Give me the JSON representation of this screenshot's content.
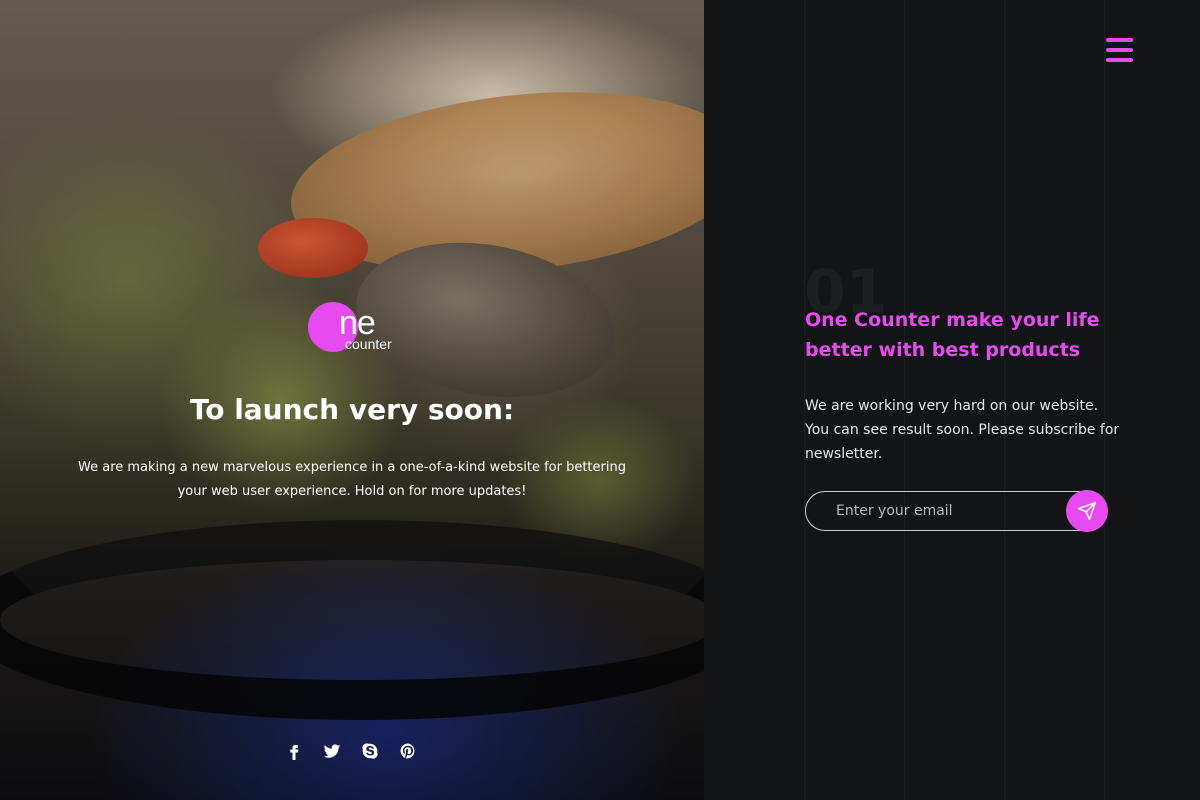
{
  "brand": {
    "logo_main": "ne",
    "logo_sub": "counter",
    "accent_color": "#e64bf0"
  },
  "hero": {
    "title": "To launch very soon:",
    "description": "We are making a new marvelous experience in a one-of-a-kind website for bettering your web user experience. Hold on for more updates!",
    "socials": [
      {
        "icon": "facebook-icon"
      },
      {
        "icon": "twitter-icon"
      },
      {
        "icon": "skype-icon"
      },
      {
        "icon": "pinterest-icon"
      }
    ]
  },
  "panel": {
    "number": "01",
    "tagline": "One Counter make your life better with best products",
    "description": "We are working very hard on our website. You can see result soon. Please subscribe for newsletter.",
    "email_placeholder": "Enter your email",
    "email_value": ""
  }
}
